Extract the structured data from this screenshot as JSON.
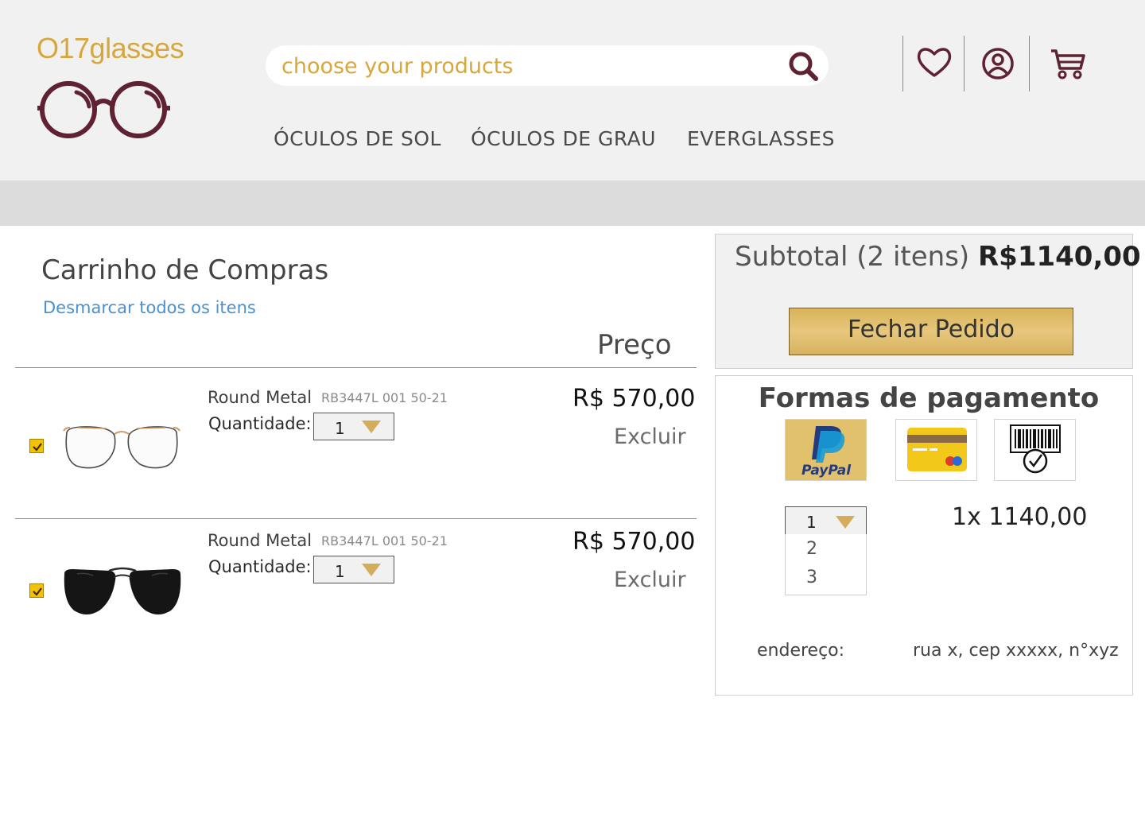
{
  "header": {
    "logo_text": "O17glasses",
    "search": {
      "placeholder": "choose your products"
    },
    "icons": [
      "heart-icon",
      "user-icon",
      "cart-icon"
    ],
    "nav": [
      "ÓCULOS DE SOL",
      "ÓCULOS DE GRAU",
      "EVERGLASSES"
    ]
  },
  "cart": {
    "title": "Carrinho de Compras",
    "deselect_label": "Desmarcar todos os itens",
    "price_header": "Preço",
    "items": [
      {
        "name": "Round Metal",
        "code": "RB3447L 001 50-21",
        "qty_label": "Quantidade:",
        "qty": "1",
        "price": "R$ 570,00",
        "delete_label": "Excluir",
        "checked": true,
        "image": "round-metal-glasses"
      },
      {
        "name": "Round Metal",
        "code": "RB3447L 001 50-21",
        "qty_label": "Quantidade:",
        "qty": "1",
        "price": "R$ 570,00",
        "delete_label": "Excluir",
        "checked": true,
        "image": "aviator-sunglasses"
      }
    ]
  },
  "summary": {
    "subtotal_label": "Subtotal (2 itens) ",
    "subtotal_value": "R$1140,00",
    "checkout_label": "Fechar Pedido"
  },
  "payment": {
    "title": "Formas de pagamento",
    "methods": [
      "paypal",
      "credit-card",
      "boleto"
    ],
    "paypal_text": "PayPal",
    "installments": {
      "selected": "1",
      "options": [
        "2",
        "3"
      ]
    },
    "installment_value": "1x 1140,00",
    "address_label": "endereço:",
    "address_value": "rua x, cep xxxxx, n°xyz"
  },
  "colors": {
    "gold": "#d7a73c",
    "burgundy": "#5e2233",
    "link_blue": "#4a90d2",
    "header_bg": "#f1f1f1"
  }
}
